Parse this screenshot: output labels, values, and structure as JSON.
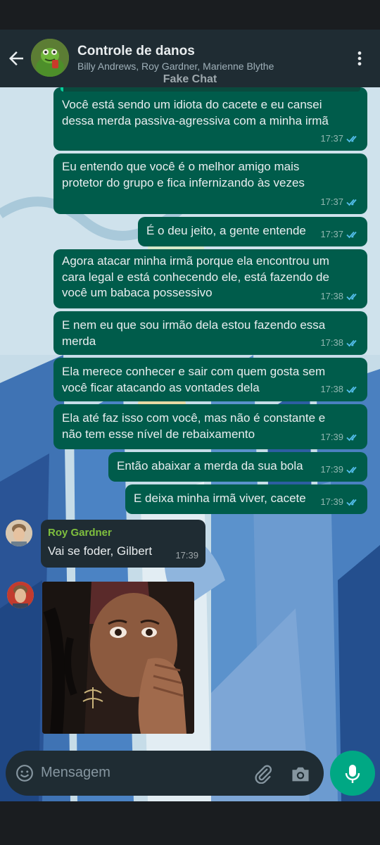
{
  "header": {
    "title": "Controle de danos",
    "members": "Billy Andrews, Roy Gardner, Marienne Blythe",
    "watermark": "Fake Chat"
  },
  "messages": [
    {
      "text": "Você está sendo um idiota do cacete e eu cansei\ndessa merda passiva-agressiva com a minha irmã",
      "time": "17:37"
    },
    {
      "text": "Eu entendo que você é o melhor amigo mais\nprotetor do grupo e fica infernizando às vezes",
      "time": "17:37"
    },
    {
      "text": "É o deu jeito, a gente entende",
      "time": "17:37"
    },
    {
      "text": "Agora atacar minha irmã porque ela encontrou um\ncara legal e está conhecendo ele, está fazendo de\nvocê um babaca possessivo",
      "time": "17:38"
    },
    {
      "text": "E nem eu que sou irmão dela estou fazendo essa\nmerda",
      "time": "17:38"
    },
    {
      "text": "Ela merece conhecer e sair com quem gosta sem\nvocê ficar atacando as vontades dela",
      "time": "17:38"
    },
    {
      "text": "Ela até faz isso com você, mas não é constante e\nnão tem esse nível de rebaixamento",
      "time": "17:39"
    },
    {
      "text": "Então abaixar a merda da sua bola",
      "time": "17:39"
    },
    {
      "text": "E deixa minha irmã viver, cacete",
      "time": "17:39"
    }
  ],
  "incoming": {
    "sender": "Roy Gardner",
    "text": "Vai se foder, Gilbert",
    "time": "17:39"
  },
  "input": {
    "placeholder": "Mensagem"
  },
  "colors": {
    "outgoing_bubble": "#005c4b",
    "incoming_bubble": "#1f2c33",
    "accent": "#00a884",
    "read_ticks": "#53bdeb"
  }
}
